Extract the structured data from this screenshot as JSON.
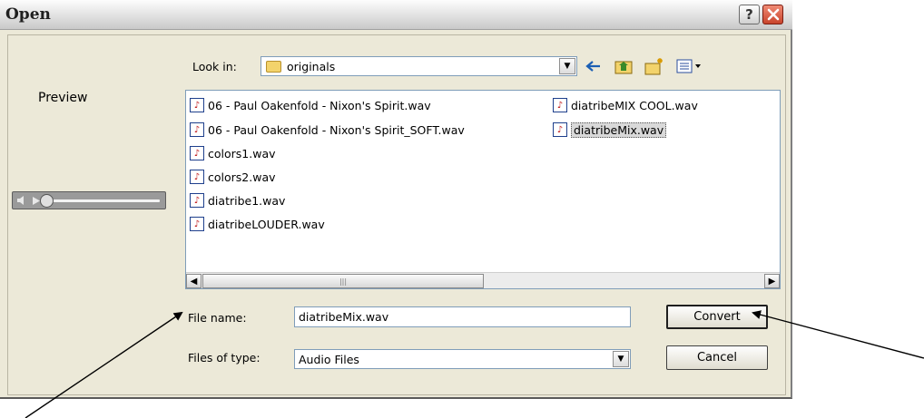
{
  "dialog": {
    "title": "Open",
    "help_label": "?",
    "close_label": "✕"
  },
  "look_in": {
    "label": "Look in:",
    "value": "originals"
  },
  "preview": {
    "label": "Preview",
    "player_position": 0.08
  },
  "files": [
    {
      "name": "06 - Paul Oakenfold - Nixon's Spirit.wav",
      "selected": false
    },
    {
      "name": "06 - Paul Oakenfold - Nixon's Spirit_SOFT.wav",
      "selected": false
    },
    {
      "name": "colors1.wav",
      "selected": false
    },
    {
      "name": "colors2.wav",
      "selected": false
    },
    {
      "name": "diatribe1.wav",
      "selected": false
    },
    {
      "name": "diatribeLOUDER.wav",
      "selected": false
    },
    {
      "name": "diatribeMIX COOL.wav",
      "selected": false
    },
    {
      "name": "diatribeMix.wav",
      "selected": true
    }
  ],
  "file_name": {
    "label": "File name:",
    "value": "diatribeMix.wav"
  },
  "file_type": {
    "label": "Files of type:",
    "value": "Audio Files"
  },
  "buttons": {
    "convert": "Convert",
    "cancel": "Cancel"
  },
  "icons": {
    "back": "back-arrow-icon",
    "up": "up-folder-icon",
    "new_folder": "new-folder-icon",
    "view_menu": "view-menu-icon",
    "file": "wav-file-icon"
  },
  "colors": {
    "dialog_bg": "#ece9d8",
    "close_red": "#c8442c",
    "input_border": "#7f9db9"
  }
}
